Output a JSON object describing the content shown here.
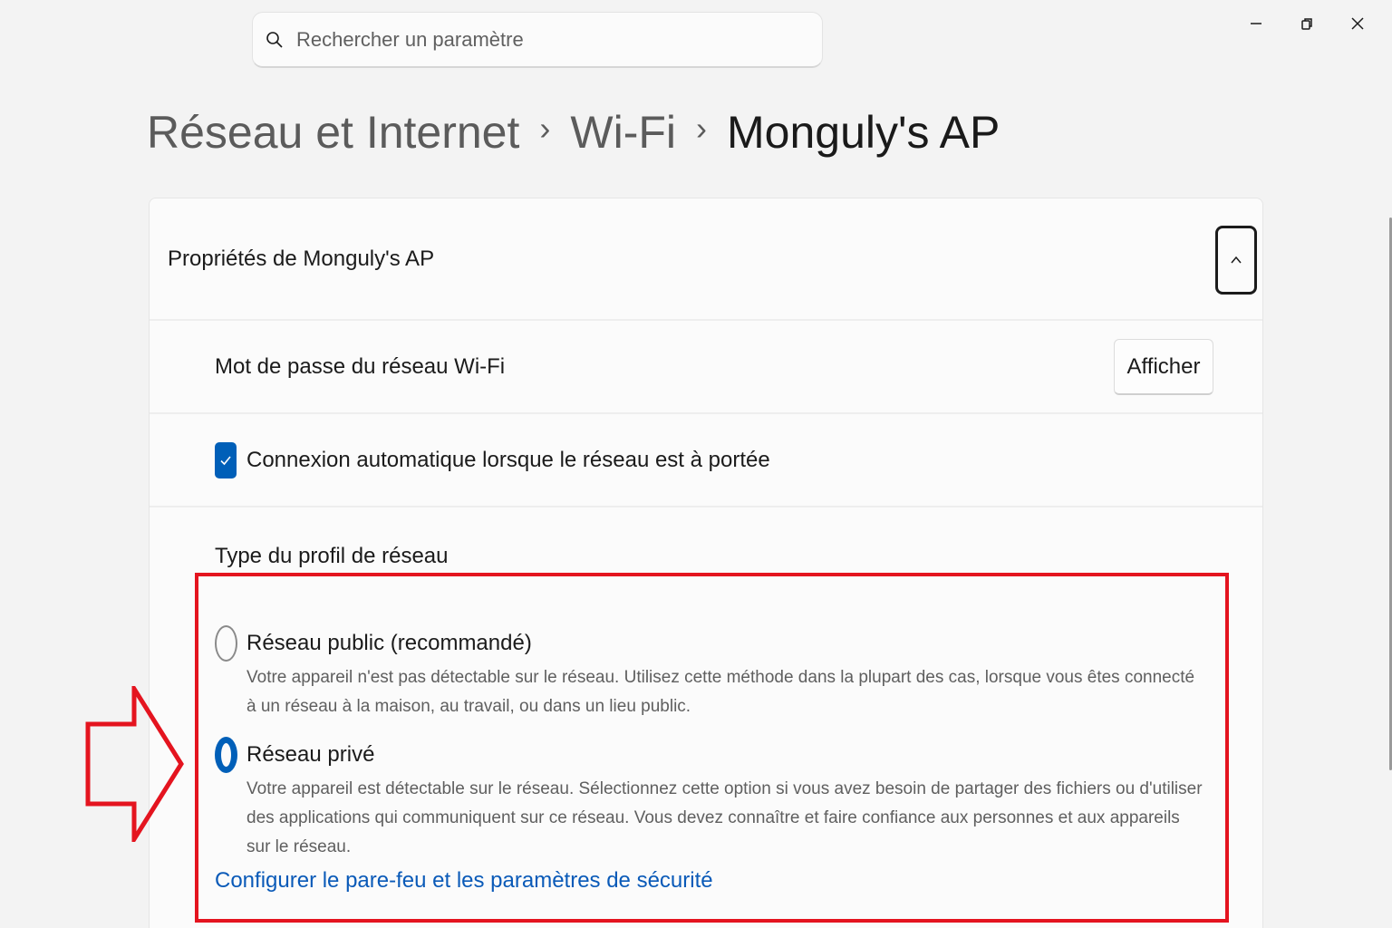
{
  "search": {
    "placeholder": "Rechercher un paramètre"
  },
  "window_controls": [
    "minimize",
    "restore",
    "close"
  ],
  "breadcrumb": [
    {
      "label": "Réseau et Internet"
    },
    {
      "label": "Wi-Fi"
    },
    {
      "label": "Monguly's AP"
    }
  ],
  "breadcrumb_separator": "›",
  "properties": {
    "title": "Propriétés de Monguly's AP",
    "expanded": true,
    "password_label": "Mot de passe du réseau Wi-Fi",
    "show_button": "Afficher",
    "auto_connect_label": "Connexion automatique lorsque le réseau est à portée",
    "auto_connect_checked": true,
    "profile_type_title": "Type du profil de réseau",
    "options": [
      {
        "title": "Réseau public (recommandé)",
        "desc": "Votre appareil n'est pas détectable sur le réseau. Utilisez cette méthode dans la plupart des cas, lorsque vous êtes connecté à un réseau à la maison, au travail, ou dans un lieu public.",
        "selected": false
      },
      {
        "title": "Réseau privé",
        "desc": "Votre appareil est détectable sur le réseau. Sélectionnez cette option si vous avez besoin de partager des fichiers ou d'utiliser des applications qui communiquent sur ce réseau. Vous devez connaître et faire confiance aux personnes et aux appareils sur le réseau.",
        "selected": true
      }
    ],
    "firewall_link": "Configurer le pare-feu et les paramètres de sécurité"
  },
  "colors": {
    "accent": "#005fb8",
    "link": "#0a5ab8",
    "annotation": "#e4141f",
    "background": "#f3f3f3"
  },
  "icons": [
    "search-icon",
    "minimize-icon",
    "restore-icon",
    "close-icon",
    "chevron-up-icon",
    "checkmark-icon"
  ]
}
